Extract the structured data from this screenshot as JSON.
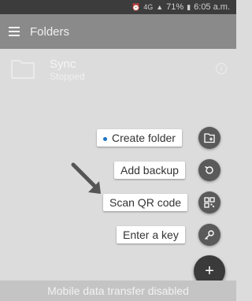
{
  "status_bar": {
    "battery_percent": "71%",
    "time": "6:05 a.m.",
    "icons": [
      "alarm-icon",
      "4g-icon",
      "signal-icon",
      "battery-icon"
    ],
    "network_label": "4G"
  },
  "toolbar": {
    "title": "Folders"
  },
  "folders": [
    {
      "name": "Sync",
      "status": "Stopped"
    }
  ],
  "fab_menu": {
    "items": [
      {
        "label": "Create folder",
        "icon": "create-folder-icon",
        "highlighted": true
      },
      {
        "label": "Add backup",
        "icon": "restore-backup-icon"
      },
      {
        "label": "Scan QR code",
        "icon": "qr-code-icon"
      },
      {
        "label": "Enter a key",
        "icon": "key-icon"
      }
    ],
    "main_icon": "+"
  },
  "bottom_bar": {
    "message": "Mobile data transfer disabled"
  },
  "colors": {
    "accent_dot": "#1a73c7",
    "fab": "#3a3a3a",
    "mini_fab": "#5a5a5a"
  }
}
